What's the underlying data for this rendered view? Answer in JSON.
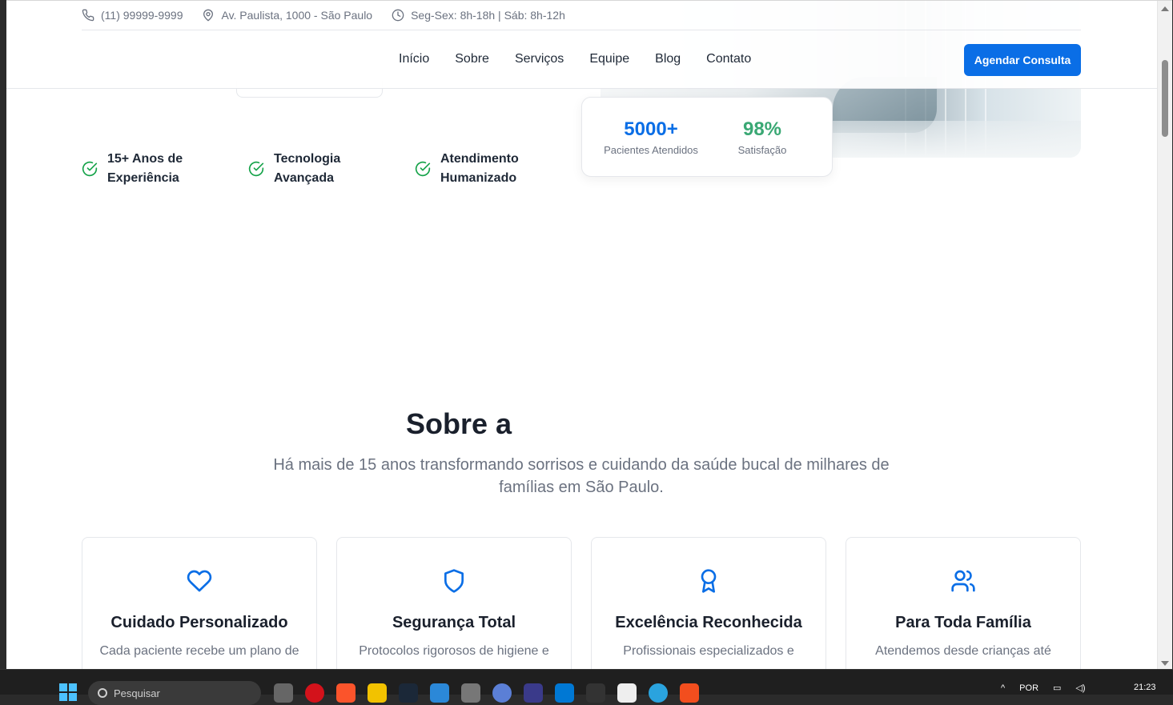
{
  "topbar": {
    "phone": "(11) 99999-9999",
    "address": "Av. Paulista, 1000 - São Paulo",
    "hours": "Seg-Sex: 8h-18h | Sáb: 8h-12h"
  },
  "nav": {
    "links": [
      "Início",
      "Sobre",
      "Serviços",
      "Equipe",
      "Blog",
      "Contato"
    ],
    "cta": "Agendar Consulta"
  },
  "stats": [
    {
      "value": "5000+",
      "label": "Pacientes Atendidos",
      "color": "#0a6ee6"
    },
    {
      "value": "98%",
      "label": "Satisfação",
      "color": "#3aa874"
    }
  ],
  "features": [
    {
      "line1": "15+ Anos de",
      "line2": "Experiência"
    },
    {
      "line1": "Tecnologia",
      "line2": "Avançada"
    },
    {
      "line1": "Atendimento",
      "line2": "Humanizado"
    }
  ],
  "about": {
    "title": "Sobre a",
    "subtitle_line1": "Há mais de 15 anos transformando sorrisos e cuidando da saúde bucal de milhares de",
    "subtitle_line2": "famílias em São Paulo."
  },
  "cards": [
    {
      "icon": "heart-icon",
      "title": "Cuidado Personalizado",
      "desc": "Cada paciente recebe um plano de"
    },
    {
      "icon": "shield-icon",
      "title": "Segurança Total",
      "desc": "Protocolos rigorosos de higiene e"
    },
    {
      "icon": "award-icon",
      "title": "Excelência Reconhecida",
      "desc": "Profissionais especializados e"
    },
    {
      "icon": "users-icon",
      "title": "Para Toda Família",
      "desc": "Atendemos desde crianças até"
    }
  ],
  "taskbar": {
    "search_placeholder": "Pesquisar",
    "language": "POR",
    "time": "21:23"
  }
}
